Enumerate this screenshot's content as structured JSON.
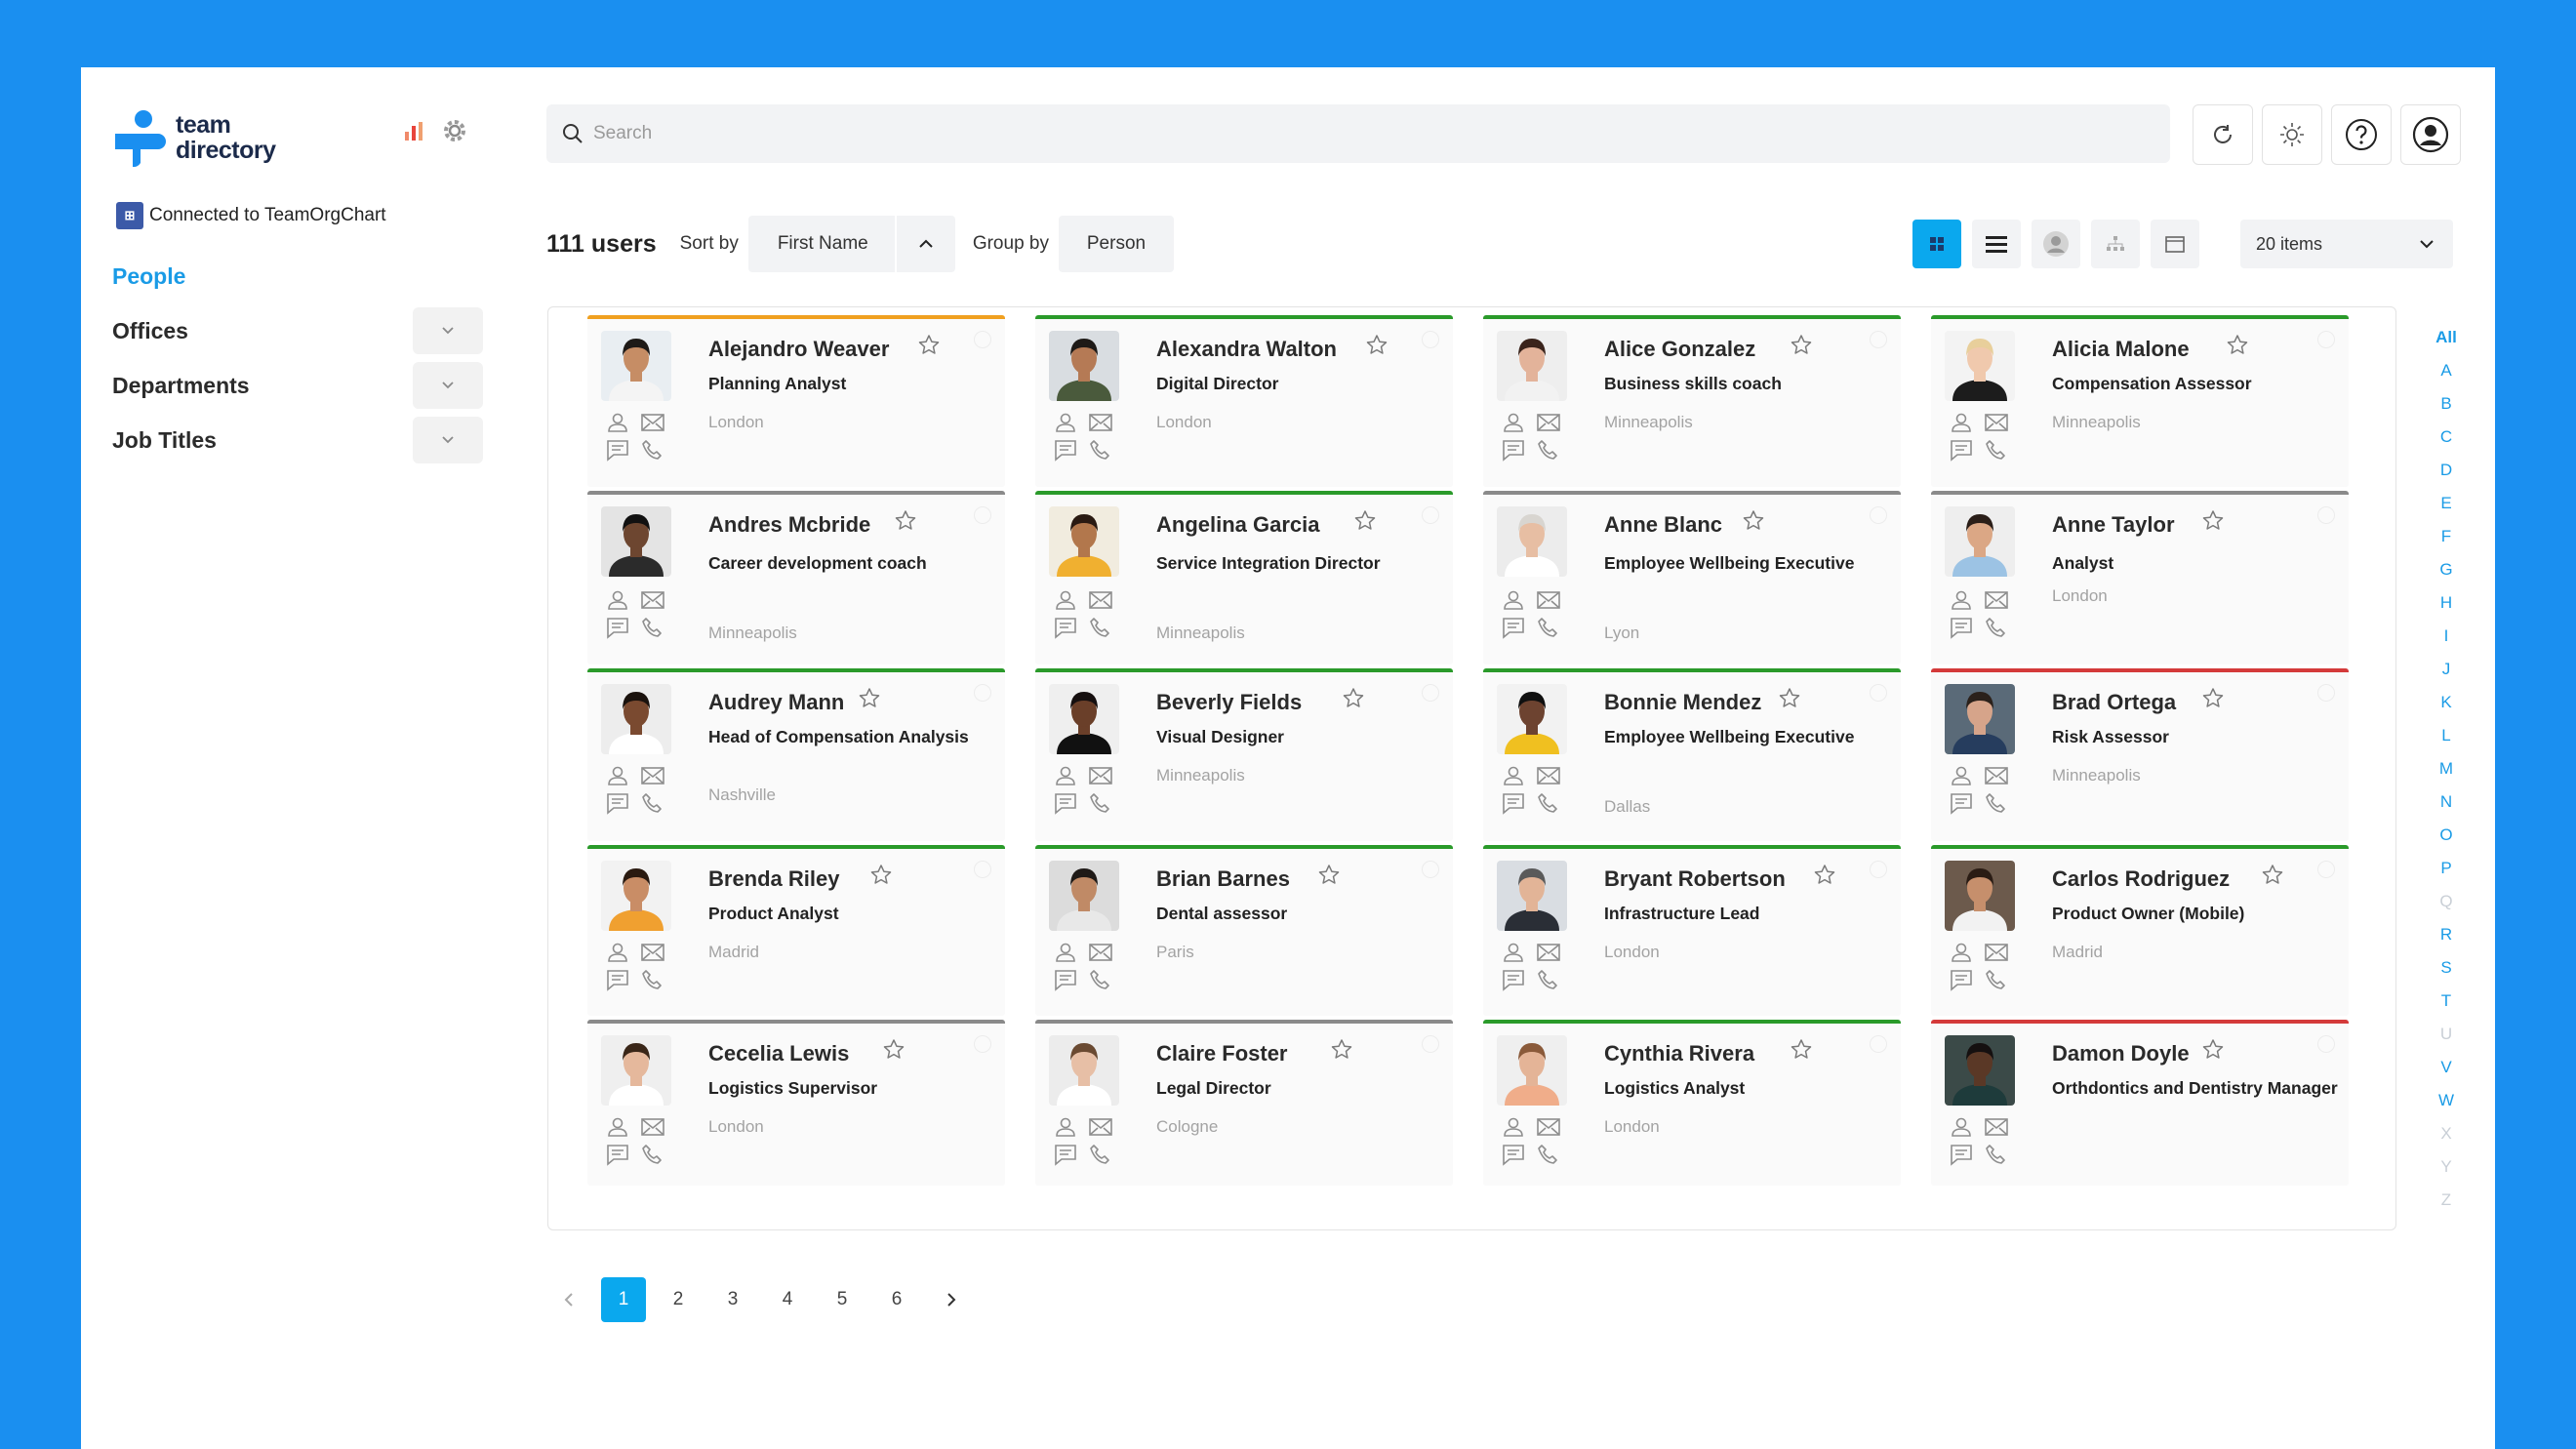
{
  "app": {
    "name_line1": "team",
    "name_line2": "directory",
    "connected": "Connected to TeamOrgChart"
  },
  "nav": [
    {
      "label": "People",
      "active": true,
      "expandable": false
    },
    {
      "label": "Offices",
      "active": false,
      "expandable": true
    },
    {
      "label": "Departments",
      "active": false,
      "expandable": true
    },
    {
      "label": "Job Titles",
      "active": false,
      "expandable": true
    }
  ],
  "search": {
    "placeholder": "Search"
  },
  "toolbar": {
    "count": "111 users",
    "sort_label": "Sort by",
    "sort_value": "First Name",
    "group_label": "Group by",
    "group_value": "Person",
    "items_per_page": "20 items"
  },
  "alphabet": [
    "All",
    "A",
    "B",
    "C",
    "D",
    "E",
    "F",
    "G",
    "H",
    "I",
    "J",
    "K",
    "L",
    "M",
    "N",
    "O",
    "P",
    "Q",
    "R",
    "S",
    "T",
    "U",
    "V",
    "W",
    "X",
    "Y",
    "Z"
  ],
  "alphabet_disabled": [
    "Q",
    "U",
    "X",
    "Y",
    "Z"
  ],
  "colors": {
    "green": "#2a9a2a",
    "orange": "#f0a020",
    "gray": "#8a8a8a",
    "red": "#d43a3a",
    "accent": "#0aa8ee"
  },
  "people": [
    {
      "name": "Alejandro Weaver",
      "title": "Planning Analyst",
      "location": "London",
      "status": "orange",
      "skin": "#c68d65",
      "hair": "#1e1a17",
      "shirt": "#f4f4f4",
      "bg": "#e9eef2"
    },
    {
      "name": "Alexandra Walton",
      "title": "Digital Director",
      "location": "London",
      "status": "green",
      "skin": "#b57a55",
      "hair": "#1e1a17",
      "shirt": "#4a5a3c",
      "bg": "#d9dde1"
    },
    {
      "name": "Alice Gonzalez",
      "title": "Business skills coach",
      "location": "Minneapolis",
      "status": "green",
      "skin": "#e3b39a",
      "hair": "#3a241c",
      "shirt": "#f2f2f2",
      "bg": "#eeeeee"
    },
    {
      "name": "Alicia Malone",
      "title": "Compensation Assessor",
      "location": "Minneapolis",
      "status": "green",
      "skin": "#f0c9ad",
      "hair": "#e8cf9b",
      "shirt": "#1c1c1c",
      "bg": "#f3f3f3"
    },
    {
      "name": "Andres Mcbride",
      "title": "Career development coach",
      "location": "Minneapolis",
      "status": "gray",
      "skin": "#6d4630",
      "hair": "#111111",
      "shirt": "#2b2b2b",
      "bg": "#e4e4e4"
    },
    {
      "name": "Angelina Garcia",
      "title": "Service Integration Director",
      "location": "Minneapolis",
      "status": "green",
      "skin": "#b2774c",
      "hair": "#2a1a12",
      "shirt": "#f0b030",
      "bg": "#f1ecdf"
    },
    {
      "name": "Anne Blanc",
      "title": "Employee Wellbeing Executive",
      "location": "Lyon",
      "status": "gray",
      "skin": "#e7bea3",
      "hair": "#d8d5d0",
      "shirt": "#ffffff",
      "bg": "#ececec"
    },
    {
      "name": "Anne Taylor",
      "title": "Analyst",
      "location": "London",
      "status": "gray",
      "skin": "#dba785",
      "hair": "#2a1e18",
      "shirt": "#9cc3e4",
      "bg": "#eeeeee"
    },
    {
      "name": "Audrey Mann",
      "title": "Head of Compensation Analysis",
      "location": "Nashville",
      "status": "green",
      "skin": "#7a4a30",
      "hair": "#1a120d",
      "shirt": "#ffffff",
      "bg": "#ededed"
    },
    {
      "name": "Beverly Fields",
      "title": "Visual Designer",
      "location": "Minneapolis",
      "status": "green",
      "skin": "#6a3f29",
      "hair": "#161010",
      "shirt": "#111111",
      "bg": "#efefef"
    },
    {
      "name": "Bonnie Mendez",
      "title": "Employee Wellbeing Executive",
      "location": "Dallas",
      "status": "green",
      "skin": "#6d4330",
      "hair": "#101010",
      "shirt": "#f0c020",
      "bg": "#f2f2f2"
    },
    {
      "name": "Brad Ortega",
      "title": "Risk Assessor",
      "location": "Minneapolis",
      "status": "red",
      "skin": "#d6a48a",
      "hair": "#2b211b",
      "shirt": "#263d5e",
      "bg": "#5a6a78"
    },
    {
      "name": "Brenda Riley",
      "title": "Product Analyst",
      "location": "Madrid",
      "status": "green",
      "skin": "#c98d66",
      "hair": "#2a1a10",
      "shirt": "#f0a030",
      "bg": "#f2f2f2"
    },
    {
      "name": "Brian Barnes",
      "title": "Dental assessor",
      "location": "Paris",
      "status": "green",
      "skin": "#c08a66",
      "hair": "#1f1a17",
      "shirt": "#e8e8e8",
      "bg": "#dcdcdc"
    },
    {
      "name": "Bryant Robertson",
      "title": "Infrastructure Lead",
      "location": "London",
      "status": "green",
      "skin": "#e2b497",
      "hair": "#5a5a5a",
      "shirt": "#2a2e36",
      "bg": "#d9dde2"
    },
    {
      "name": "Carlos Rodriguez",
      "title": "Product Owner (Mobile)",
      "location": "Madrid",
      "status": "green",
      "skin": "#c68f6c",
      "hair": "#2a1c14",
      "shirt": "#f2f2f2",
      "bg": "#6c5a4c"
    },
    {
      "name": "Cecelia Lewis",
      "title": "Logistics Supervisor",
      "location": "London",
      "status": "gray",
      "skin": "#e5b89c",
      "hair": "#3a2618",
      "shirt": "#ffffff",
      "bg": "#efefef"
    },
    {
      "name": "Claire Foster",
      "title": "Legal Director",
      "location": "Cologne",
      "status": "gray",
      "skin": "#e7bfa6",
      "hair": "#6a4a32",
      "shirt": "#ffffff",
      "bg": "#ececec"
    },
    {
      "name": "Cynthia Rivera",
      "title": "Logistics Analyst",
      "location": "London",
      "status": "green",
      "skin": "#e4b497",
      "hair": "#8a5a3a",
      "shirt": "#f0ad8a",
      "bg": "#efefef"
    },
    {
      "name": "Damon Doyle",
      "title": "Orthdontics and Dentistry Manager",
      "location": "",
      "status": "red",
      "skin": "#5a3826",
      "hair": "#151010",
      "shirt": "#1e3b3b",
      "bg": "#3b4a48"
    }
  ],
  "pagination": {
    "pages": [
      "1",
      "2",
      "3",
      "4",
      "5",
      "6"
    ],
    "current": "1"
  }
}
